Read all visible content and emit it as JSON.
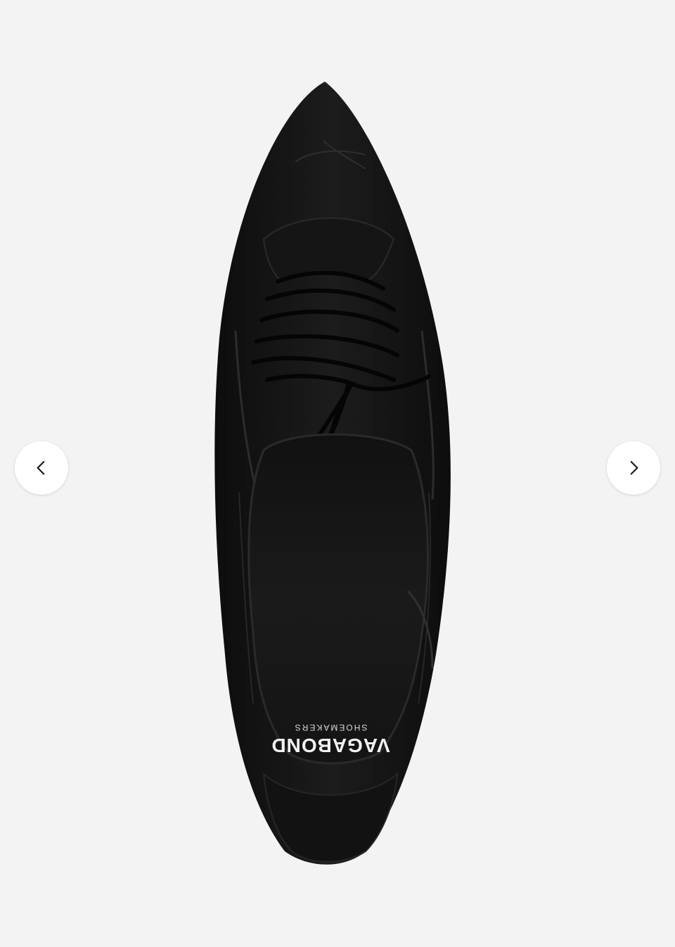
{
  "gallery": {
    "prev_icon": "chevron-left-icon",
    "next_icon": "chevron-right-icon",
    "background": "#f3f3f3"
  },
  "product": {
    "brand_logo_text": "VAGABOND",
    "brand_logo_subtext": "SHOEMAKERS"
  }
}
